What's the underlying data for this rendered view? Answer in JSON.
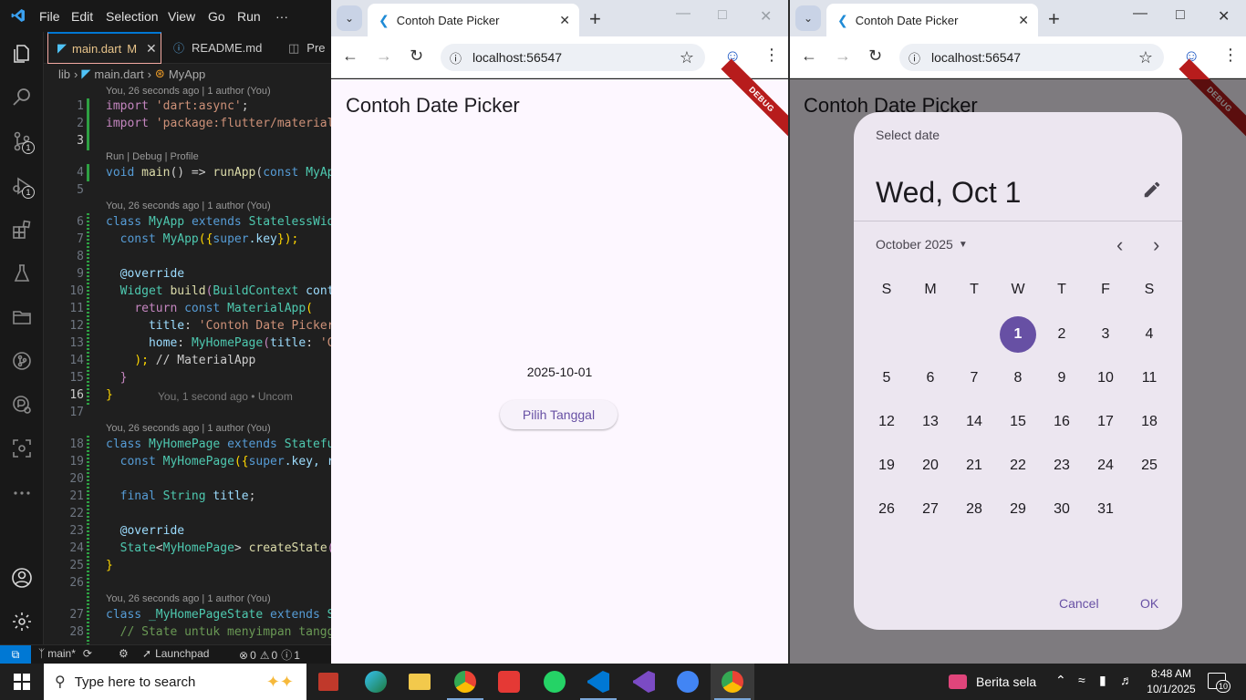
{
  "vscode": {
    "menu": [
      "File",
      "Edit",
      "Selection",
      "View",
      "Go",
      "Run",
      "···"
    ],
    "tabs": [
      {
        "label": "main.dart",
        "suffix": "M"
      },
      {
        "label": "README.md"
      },
      {
        "label": "Pre"
      }
    ],
    "breadcrumb": {
      "folder": "lib",
      "file": "main.dart",
      "symbol": "MyApp"
    },
    "badges": {
      "source_control": "1",
      "run_debug": "1"
    },
    "lens": {
      "blame": "You, 26 seconds ago | 1 author (You)",
      "run": "Run | Debug | Profile",
      "inline_blame": "You, 1 second ago • Uncom"
    },
    "line_numbers": [
      "1",
      "2",
      "3",
      "4",
      "5",
      "6",
      "7",
      "8",
      "9",
      "10",
      "11",
      "12",
      "13",
      "14",
      "15",
      "16",
      "17",
      "18",
      "19",
      "20",
      "21",
      "22",
      "23",
      "24",
      "25",
      "26",
      "27",
      "28"
    ],
    "code": {
      "l1": [
        "import ",
        "'dart:async'",
        ";"
      ],
      "l2": [
        "import ",
        "'package:flutter/material"
      ],
      "l4": [
        "void ",
        "main",
        "() => ",
        "runApp",
        "(",
        "const ",
        "MyAp"
      ],
      "l6": [
        "class ",
        "MyApp ",
        "extends ",
        "StatelessWid"
      ],
      "l7": [
        "const ",
        "MyApp",
        "({",
        "super",
        ".key",
        "});"
      ],
      "l9": [
        "@override"
      ],
      "l10": [
        "Widget ",
        "build",
        "(",
        "BuildContext ",
        "cont"
      ],
      "l11": [
        "return ",
        "const ",
        "MaterialApp",
        "("
      ],
      "l12": [
        "title",
        ": ",
        "'Contoh Date Picker"
      ],
      "l13": [
        "home",
        ": ",
        "MyHomePage",
        "(",
        "title",
        ": ",
        "'C"
      ],
      "l14": [
        "); ",
        "// MaterialApp"
      ],
      "l15": [
        "}"
      ],
      "l16": [
        "}"
      ],
      "l18": [
        "class ",
        "MyHomePage ",
        "extends ",
        "Statefu"
      ],
      "l19": [
        "const ",
        "MyHomePage",
        "({",
        "super",
        ".key, ",
        "r"
      ],
      "l21": [
        "final ",
        "String ",
        "title",
        ";"
      ],
      "l23": [
        "@override"
      ],
      "l24": [
        "State",
        "<",
        "MyHomePage",
        "> ",
        "createState",
        "("
      ],
      "l25": [
        "}"
      ],
      "l27": [
        "class ",
        "_MyHomePageState ",
        "extends ",
        "S"
      ],
      "l28": [
        "// State untuk menyimpan tangg"
      ]
    },
    "status": {
      "branch": "main*",
      "launchpad": "Launchpad",
      "errors": "0",
      "warnings": "0",
      "info": "1"
    }
  },
  "chrome_left": {
    "tab_title": "Contoh Date Picker",
    "url": "localhost:56547",
    "app_title": "Contoh Date Picker",
    "debug": "DEBUG",
    "selected_date": "2025-10-01",
    "button_label": "Pilih Tanggal"
  },
  "chrome_right": {
    "tab_title": "Contoh Date Picker",
    "url": "localhost:56547",
    "app_title": "Contoh Date Picker",
    "debug": "DEBUG",
    "picker": {
      "help_text": "Select date",
      "headline": "Wed, Oct 1",
      "month_label": "October 2025",
      "weekdays": [
        "S",
        "M",
        "T",
        "W",
        "T",
        "F",
        "S"
      ],
      "days": [
        "1",
        "2",
        "3",
        "4",
        "5",
        "6",
        "7",
        "8",
        "9",
        "10",
        "11",
        "12",
        "13",
        "14",
        "15",
        "16",
        "17",
        "18",
        "19",
        "20",
        "21",
        "22",
        "23",
        "24",
        "25",
        "26",
        "27",
        "28",
        "29",
        "30",
        "31"
      ],
      "first_weekday_index": 3,
      "selected_day": "1",
      "cancel": "Cancel",
      "ok": "OK"
    }
  },
  "taskbar": {
    "search_placeholder": "Type here to search",
    "news": "Berita sela",
    "time": "8:48 AM",
    "date": "10/1/2025",
    "notifications": "10"
  },
  "colors": {
    "vscode_accent": "#0078d4",
    "flutter_primary": "#6750a4",
    "dialog_surface": "#ece6f0",
    "debug_banner": "#b71c1c"
  }
}
